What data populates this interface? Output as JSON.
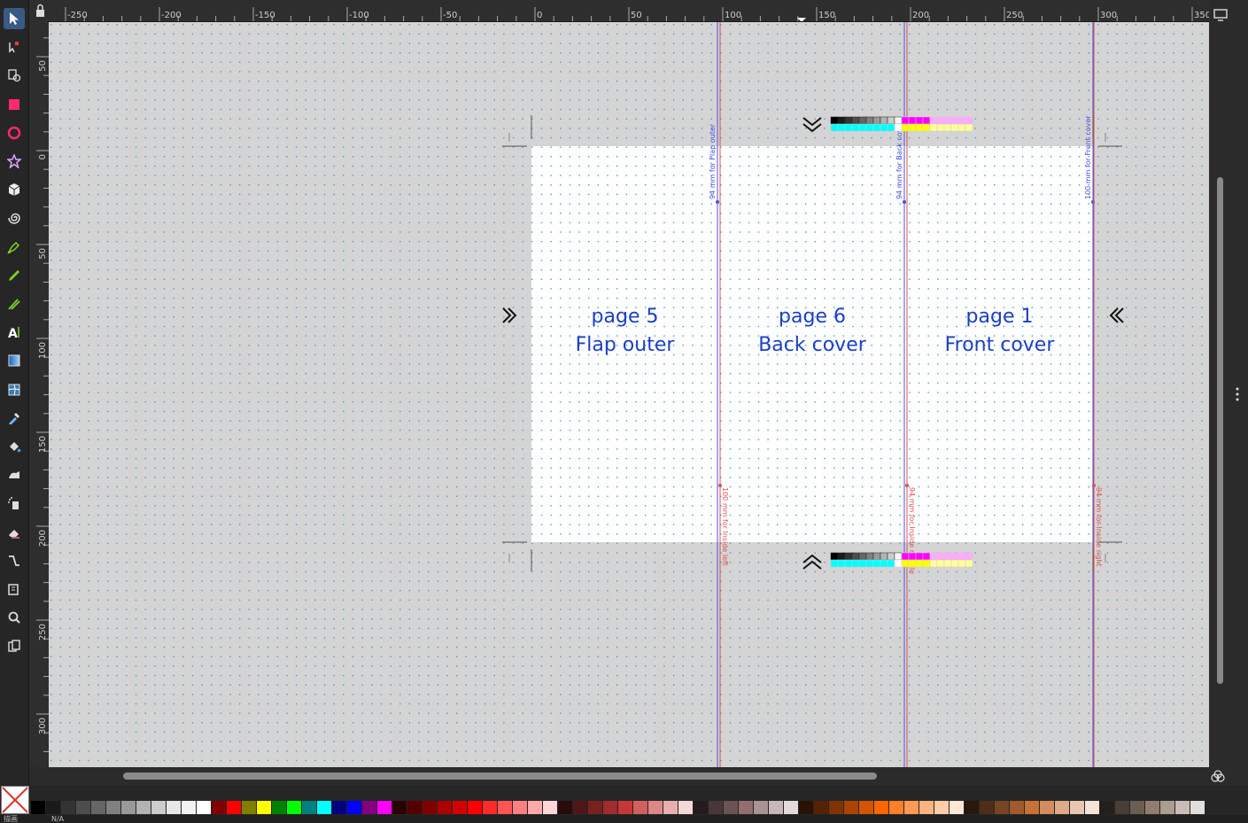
{
  "toolbar": {
    "tools": [
      {
        "name": "selector-icon",
        "active": true
      },
      {
        "name": "node-tool-icon"
      },
      {
        "name": "pages-tool-icon"
      },
      {
        "name": "rectangle-tool-icon"
      },
      {
        "name": "ellipse-tool-icon"
      },
      {
        "name": "star-tool-icon"
      },
      {
        "name": "box3d-tool-icon"
      },
      {
        "name": "spiral-tool-icon"
      },
      {
        "name": "pen-tool-icon"
      },
      {
        "name": "pencil-tool-icon"
      },
      {
        "name": "calligraphy-tool-icon"
      },
      {
        "name": "text-tool-icon"
      },
      {
        "name": "gradient-tool-icon"
      },
      {
        "name": "mesh-tool-icon"
      },
      {
        "name": "dropper-tool-icon"
      },
      {
        "name": "paint-bucket-icon"
      },
      {
        "name": "tweak-tool-icon"
      },
      {
        "name": "spray-tool-icon"
      },
      {
        "name": "eraser-tool-icon"
      },
      {
        "name": "connector-tool-icon"
      },
      {
        "name": "measure-tool-icon"
      },
      {
        "name": "zoom-tool-icon"
      },
      {
        "name": "clone-pages-icon"
      }
    ]
  },
  "rulers": {
    "top_labels": [
      "-250",
      "-200",
      "-150",
      "-100",
      "-50",
      "0",
      "50",
      "100",
      "150",
      "200",
      "250",
      "300",
      "350"
    ],
    "left_labels": [
      "50",
      "0",
      "50",
      "100",
      "150",
      "200",
      "250",
      "300"
    ]
  },
  "pages": [
    {
      "number": "page 5",
      "name": "Flap outer"
    },
    {
      "number": "page 6",
      "name": "Back cover"
    },
    {
      "number": "page 1",
      "name": "Front cover"
    }
  ],
  "guides": {
    "blue": [
      "94 mm for Flap outer",
      "94 mm for Back cover",
      "100 mm for Front cover"
    ],
    "red": [
      "100 mm for Inside left",
      "94 mm for Inside middle",
      "94 mm for Inside right"
    ]
  },
  "colors": {
    "canvas_bg": "#d4d4d4",
    "page_bg": "#ffffff",
    "grid_dot": "#3b9ad6",
    "page_text": "#1a3fc6",
    "guide_blue": "#4a50e0",
    "guide_red": "#e05050"
  },
  "status": {
    "label1": "描画",
    "label2": "N/A"
  },
  "palette": [
    "#000000",
    "#1a1a1a",
    "#333333",
    "#4d4d4d",
    "#666666",
    "#808080",
    "#999999",
    "#b3b3b3",
    "#cccccc",
    "#e6e6e6",
    "#f2f2f2",
    "#ffffff",
    "#800000",
    "#ff0000",
    "#808000",
    "#ffff00",
    "#008000",
    "#00ff00",
    "#008080",
    "#00ffff",
    "#000080",
    "#0000ff",
    "#800080",
    "#ff00ff",
    "#2b0000",
    "#550000",
    "#800000",
    "#aa0000",
    "#d40000",
    "#ff0000",
    "#ff2a2a",
    "#ff5555",
    "#ff8080",
    "#ffaaaa",
    "#ffd5d5",
    "#280b0b",
    "#501616",
    "#782121",
    "#a02c2c",
    "#c83737",
    "#d35f5f",
    "#de8787",
    "#e9afaf",
    "#f4d7d7",
    "#241c1c",
    "#483737",
    "#6c5353",
    "#916f6f",
    "#ac9393",
    "#c8b7b7",
    "#e3dbdb",
    "#2b1100",
    "#552200",
    "#803300",
    "#aa4400",
    "#d45500",
    "#ff6600",
    "#ff7f2a",
    "#ff9955",
    "#ffb380",
    "#ffccaa",
    "#ffe6d5",
    "#28170b",
    "#502d16",
    "#784421",
    "#a05a2c",
    "#c87137",
    "#d38d5f",
    "#deaa87",
    "#e9c6af",
    "#f4e3d7",
    "#241f1c",
    "#483e37",
    "#6c5d53",
    "#917c6f",
    "#ac9d93",
    "#c8beb7",
    "#e3dedb"
  ]
}
